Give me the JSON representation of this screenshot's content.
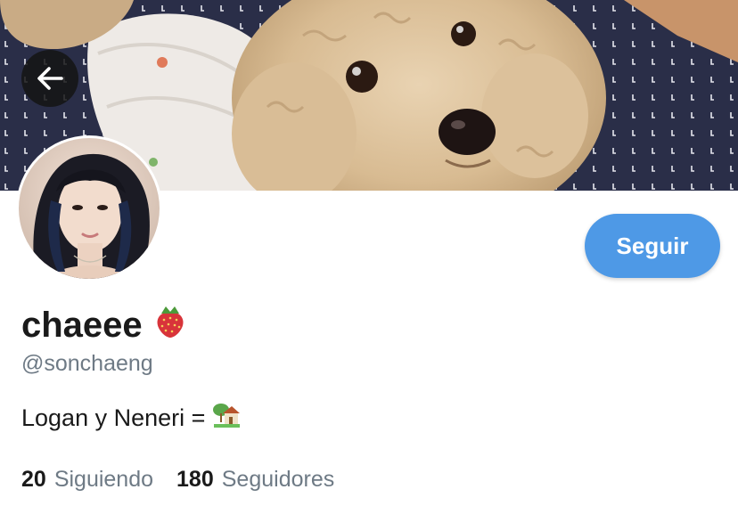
{
  "profile": {
    "display_name": "chaeee",
    "name_emoji": "strawberry",
    "handle": "@sonchaeng",
    "bio_text": "Logan y Neneri =",
    "bio_emoji": "house-with-garden",
    "follow_label": "Seguir"
  },
  "stats": {
    "following_count": "20",
    "following_label": "Siguiendo",
    "followers_count": "180",
    "followers_label": "Seguidores"
  },
  "header": {
    "back_icon": "arrow-left-icon",
    "banner": "photo of a fluffy apricot poodle on a blanket"
  },
  "colors": {
    "accent": "#4e99e6",
    "text_primary": "#1a1a1a",
    "text_secondary": "#6e7a85"
  }
}
